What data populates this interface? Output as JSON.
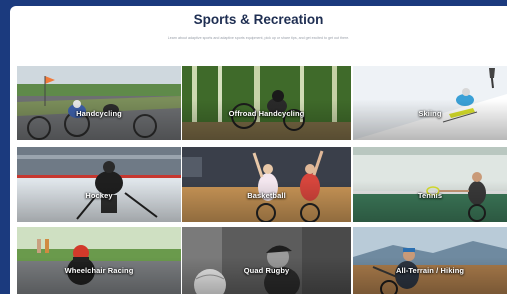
{
  "page": {
    "title": "Sports & Recreation",
    "subtitle": "Learn about adaptive sports and adaptive sports equipment, pick up or share tips, and get excited to get out there."
  },
  "tiles": [
    {
      "label": "Handcycling",
      "icon": "handcycle-photo"
    },
    {
      "label": "Offroad Handcycling",
      "icon": "offroad-handcycle-photo"
    },
    {
      "label": "Skiing",
      "icon": "sit-ski-photo"
    },
    {
      "label": "Hockey",
      "icon": "sled-hockey-photo"
    },
    {
      "label": "Basketball",
      "icon": "wheelchair-basketball-photo"
    },
    {
      "label": "Tennis",
      "icon": "wheelchair-tennis-photo"
    },
    {
      "label": "Wheelchair Racing",
      "icon": "wheelchair-racing-photo"
    },
    {
      "label": "Quad Rugby",
      "icon": "quad-rugby-photo"
    },
    {
      "label": "All-Terrain / Hiking",
      "icon": "all-terrain-hiking-photo"
    }
  ]
}
